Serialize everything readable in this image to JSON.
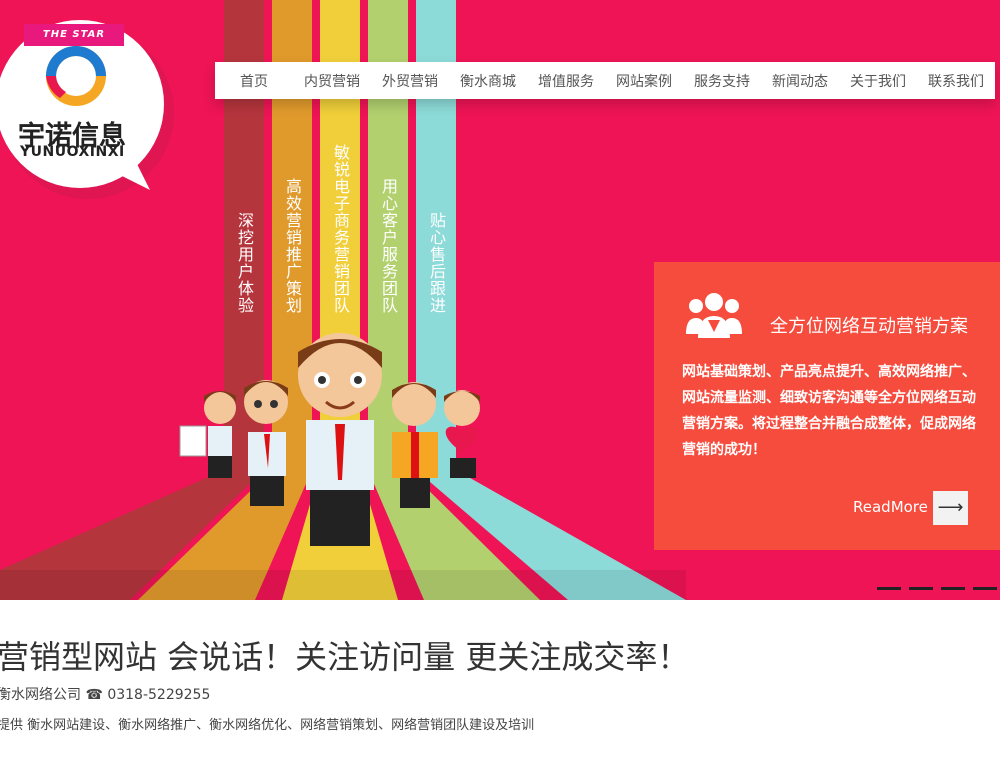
{
  "logo": {
    "tag": "THE STAR",
    "name": "宇诺信息",
    "pinyin": "YUNUOXINXI"
  },
  "nav": {
    "items": [
      "首页",
      "内贸营销",
      "外贸营销",
      "衡水商城",
      "增值服务",
      "网站案例",
      "服务支持",
      "新闻动态",
      "关于我们",
      "联系我们"
    ]
  },
  "hero": {
    "stripes": [
      "深挖用户体验",
      "高效营销推广策划",
      "敏锐电子商务营销团队",
      "用心客户服务团队",
      "贴心售后跟进"
    ]
  },
  "info_box": {
    "title": "全方位网络互动营销方案",
    "body": "网站基础策划、产品亮点提升、高效网络推广、网站流量监测、细致访客沟通等全方位网络互动营销方案。将过程整合并融合成整体，促成网络营销的成功！",
    "more": "ReadMore",
    "arrow": "⟶"
  },
  "slider": {
    "count": 5,
    "active": 0
  },
  "content": {
    "headline": "营销型网站 会说话！关注访问量 更关注成交率！",
    "contact": "衡水网络公司 ☎ 0318-5229255",
    "services": "提供 衡水网站建设、衡水网络推广、衡水网络优化、网络营销策划、网络营销团队建设及培训"
  },
  "colors": {
    "hero_bg": "#ee1455",
    "info_bg": "#f54c3d",
    "stripe_1": "#b5353d",
    "stripe_2": "#e09a2c",
    "stripe_3": "#f0cf3a",
    "stripe_4": "#b2d06e",
    "stripe_5": "#8ddbd9"
  }
}
